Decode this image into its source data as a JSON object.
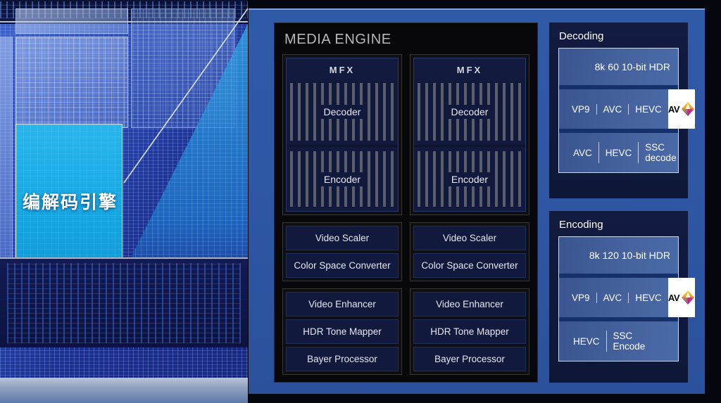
{
  "die_photo": {
    "highlight_label": "编解码引擎"
  },
  "media_engine": {
    "title": "MEDIA ENGINE",
    "columns": [
      {
        "mfx": {
          "label": "MFX",
          "bands": [
            "Decoder",
            "Encoder"
          ]
        },
        "group_a": [
          "Video Scaler",
          "Color Space Converter"
        ],
        "group_b": [
          "Video Enhancer",
          "HDR Tone Mapper",
          "Bayer Processor"
        ]
      },
      {
        "mfx": {
          "label": "MFX",
          "bands": [
            "Decoder",
            "Encoder"
          ]
        },
        "group_a": [
          "Video Scaler",
          "Color Space Converter"
        ],
        "group_b": [
          "Video Enhancer",
          "HDR Tone Mapper",
          "Bayer Processor"
        ]
      }
    ]
  },
  "decoding": {
    "title": "Decoding",
    "spec": "8k 60 10-bit HDR",
    "codecs": [
      "VP9",
      "AVC",
      "HEVC"
    ],
    "av1_logo": "AV1",
    "av1_text": "AV",
    "bottom": [
      "AVC",
      "HEVC",
      "SSC decode"
    ]
  },
  "encoding": {
    "title": "Encoding",
    "spec": "8k 120 10-bit HDR",
    "codecs": [
      "VP9",
      "AVC",
      "HEVC"
    ],
    "av1_logo": "AV1",
    "av1_text": "AV",
    "bottom": [
      "HEVC",
      "SSC Encode"
    ]
  },
  "colors": {
    "panel_blue": "#2f5aa8",
    "die_highlight_cyan": "#17a8e4",
    "engine_black": "#08080a",
    "cell_navy": "#111a3d",
    "band_blue": "#46639f",
    "av1_white": "#ffffff"
  }
}
